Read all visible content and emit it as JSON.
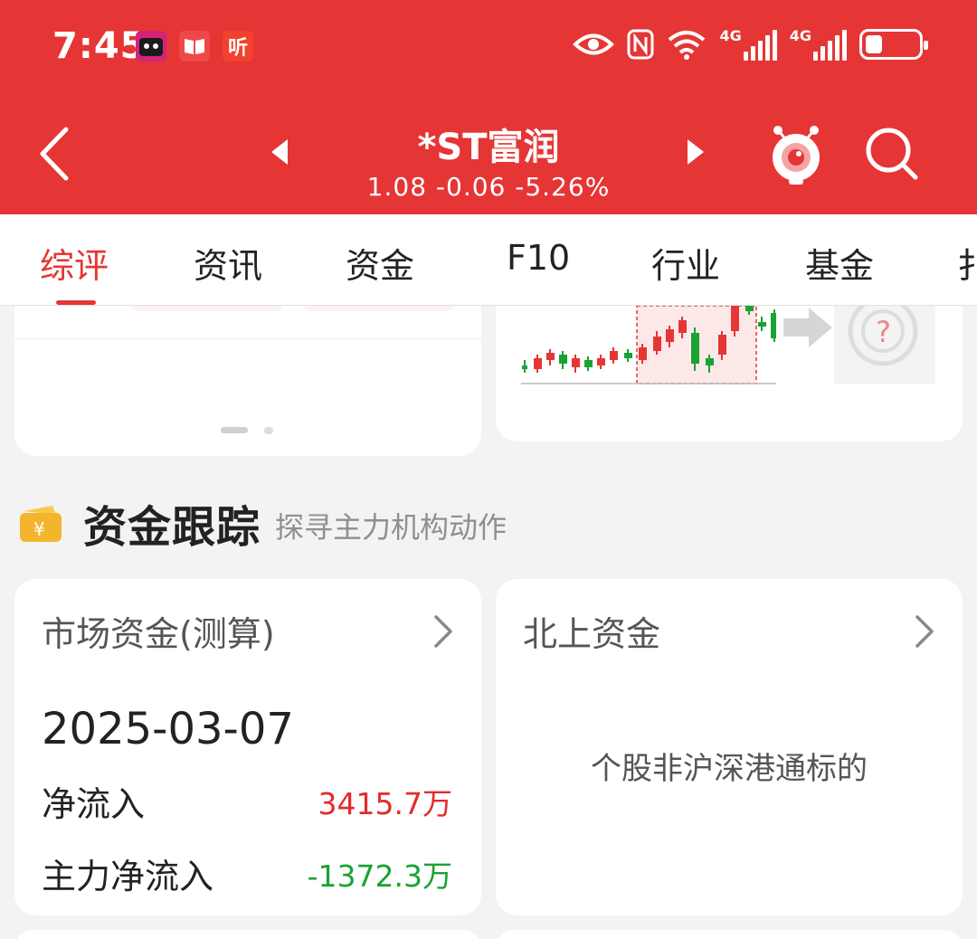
{
  "status_bar": {
    "time": "7:45",
    "network_1": "4G",
    "network_2": "4G",
    "app_icon_3": "听"
  },
  "header": {
    "title": "*ST富润",
    "quote": "1.08 -0.06 -5.26%",
    "accent_color": "#e63535"
  },
  "tabs": [
    {
      "label": "综评",
      "active": true
    },
    {
      "label": "资讯"
    },
    {
      "label": "资金"
    },
    {
      "label": "F10"
    },
    {
      "label": "行业"
    },
    {
      "label": "基金"
    },
    {
      "label": "扌"
    }
  ],
  "section": {
    "title": "资金跟踪",
    "subtitle": "探寻主力机构动作",
    "icon_symbol": "¥"
  },
  "market_card": {
    "title": "市场资金(测算)",
    "date": "2025-03-07",
    "net_inflow_label": "净流入",
    "net_inflow_value": "3415.7万",
    "main_inflow_label": "主力净流入",
    "main_inflow_value": "-1372.3万"
  },
  "north_card": {
    "title": "北上资金",
    "message": "个股非沪深港通标的"
  }
}
